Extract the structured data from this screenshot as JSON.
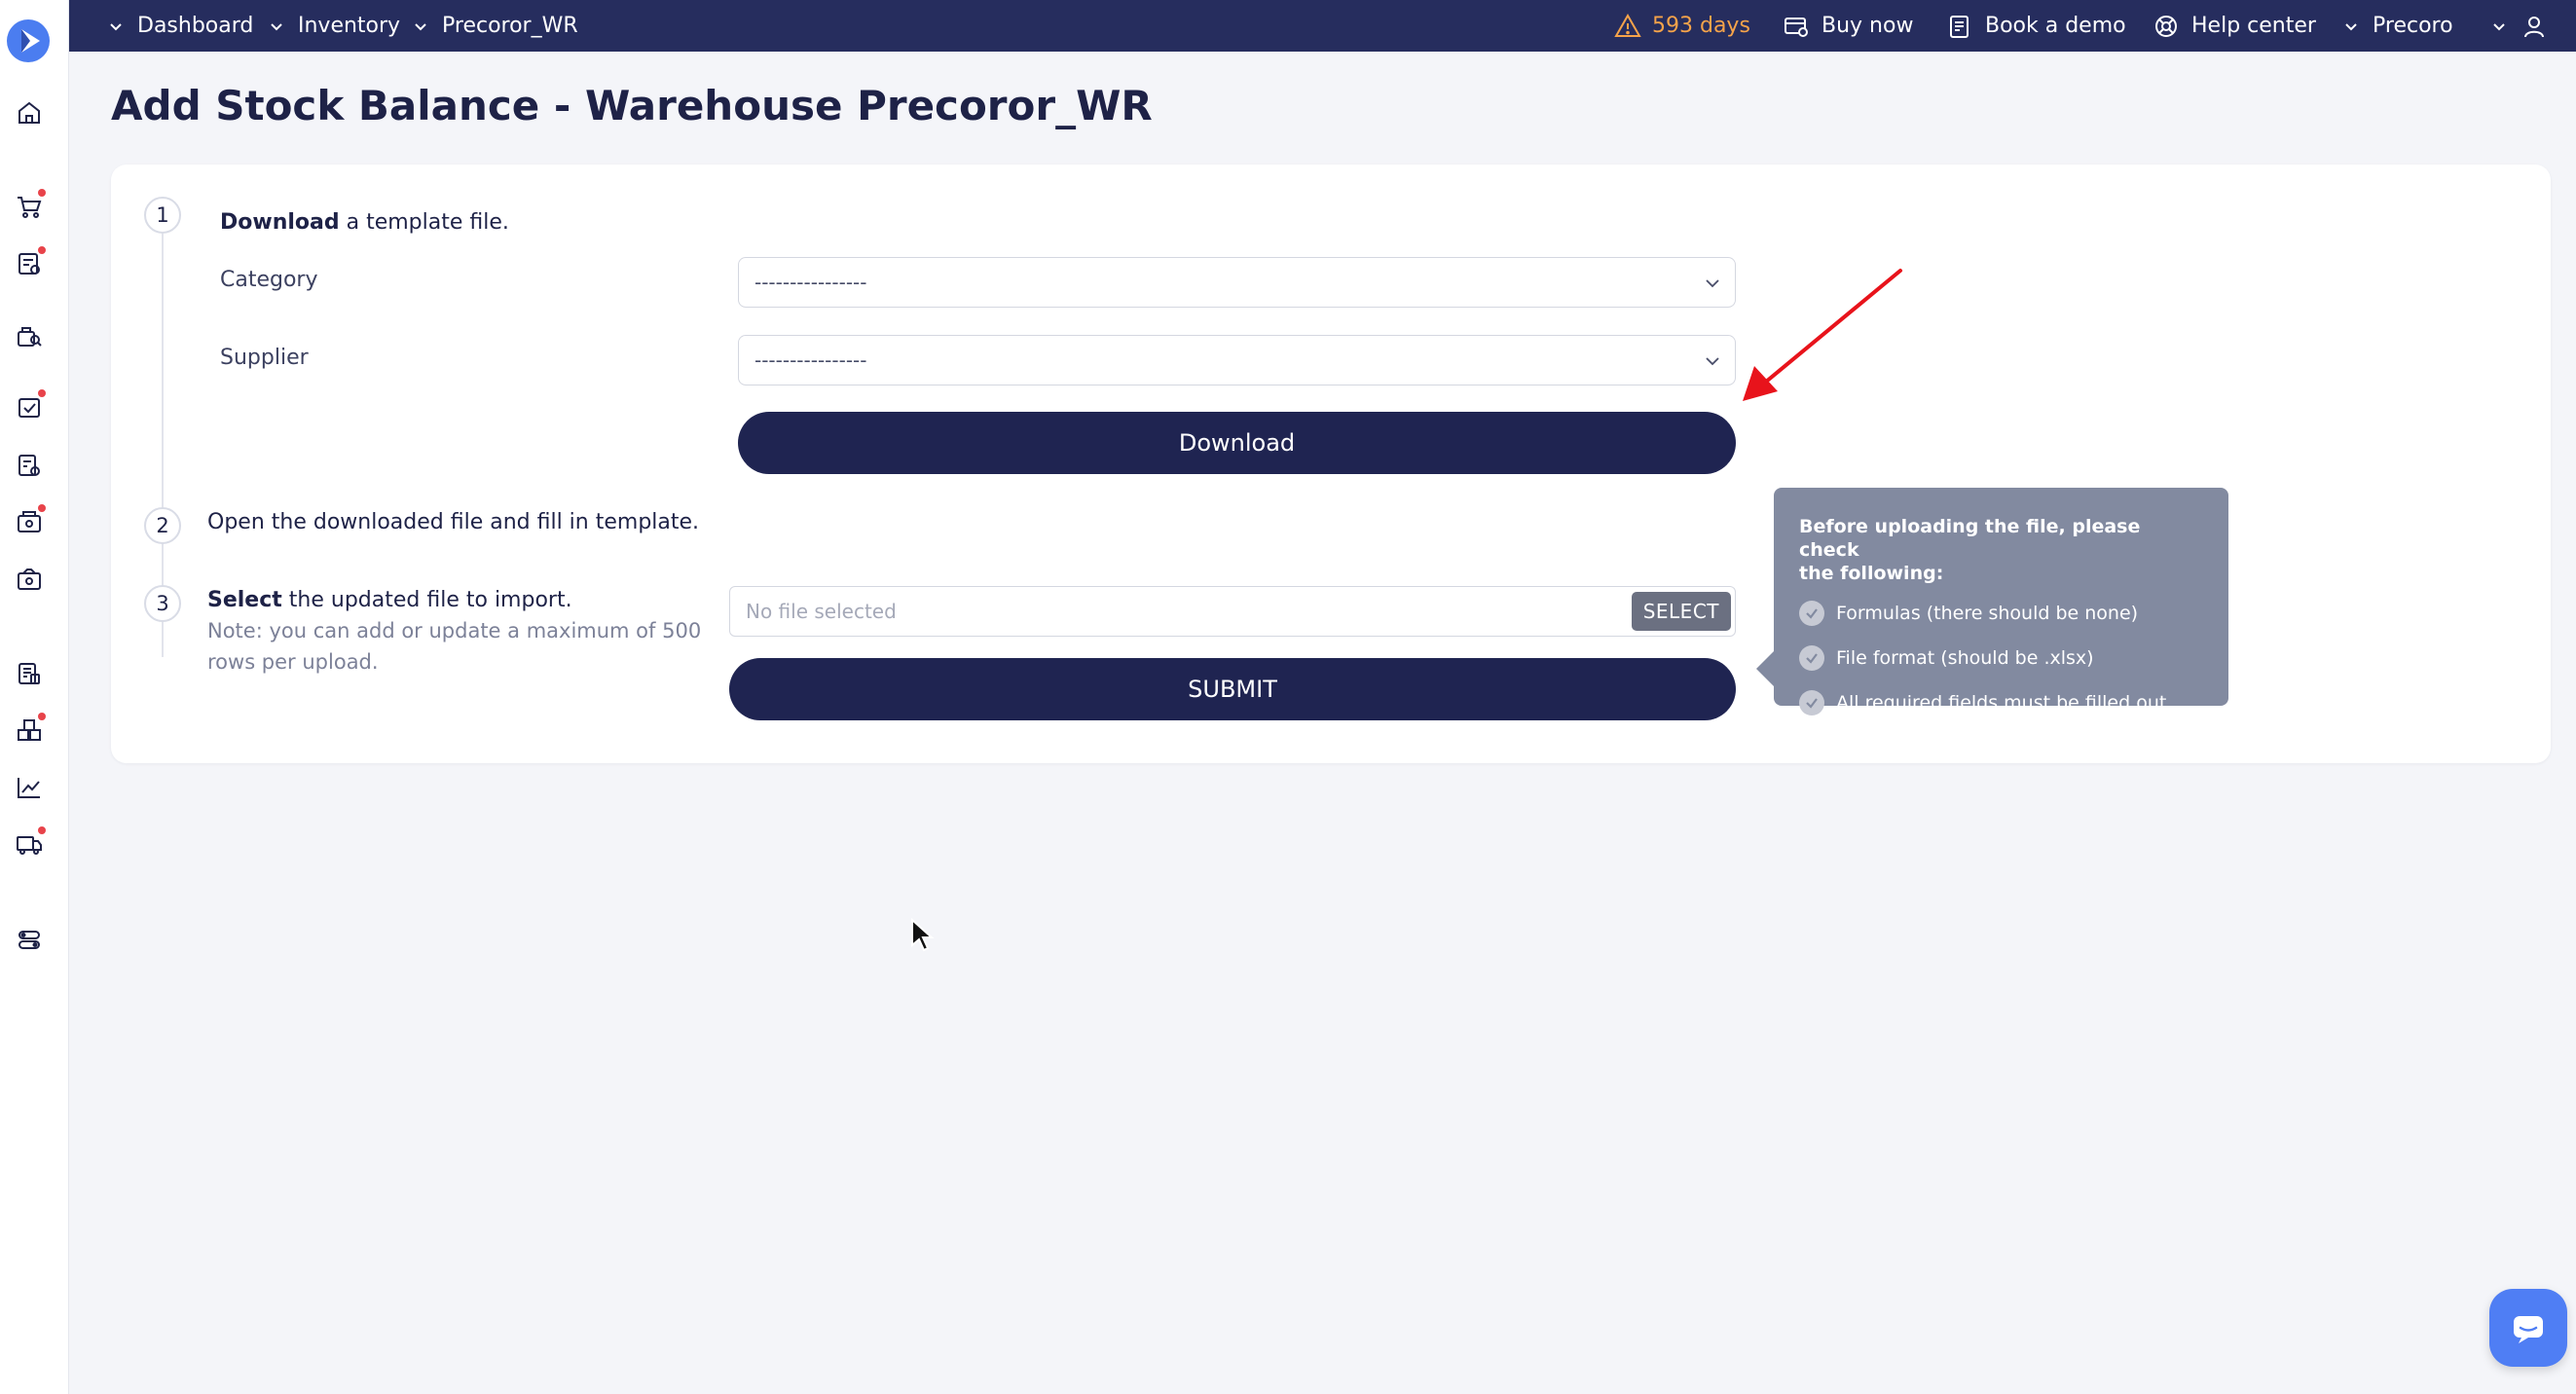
{
  "topbar": {
    "breadcrumb": [
      "Dashboard",
      "Inventory",
      "Precoror_WR"
    ],
    "trial_days": "593 days",
    "buy_now": "Buy now",
    "book_demo": "Book a demo",
    "help_center": "Help center",
    "company": "Precoro"
  },
  "sidebar": {
    "icons": [
      "home-icon",
      "purchase-cart-icon",
      "invoice-icon",
      "warehouse-icon",
      "approvals-icon",
      "receipts-icon",
      "payments-icon",
      "budgets-icon",
      "catalog-icon",
      "inventory-icon",
      "analytics-icon",
      "supplier-delivery-icon",
      "settings-icon"
    ]
  },
  "page": {
    "title": "Add Stock Balance - Warehouse Precoror_WR"
  },
  "step1": {
    "number": "1",
    "bold": "Download",
    "text": " a template file.",
    "category_label": "Category",
    "category_value": "----------------",
    "supplier_label": "Supplier",
    "supplier_value": "----------------",
    "download_button": "Download"
  },
  "step2": {
    "number": "2",
    "text": "Open the downloaded file and fill in template."
  },
  "step3": {
    "number": "3",
    "bold": "Select",
    "text": " the updated file to import.",
    "note_line1": "Note: you can add or update a maximum of 500",
    "note_line2": "rows per upload.",
    "file_placeholder": "No file selected",
    "select_button": "SELECT",
    "submit_button": "SUBMIT"
  },
  "tooltip": {
    "title_line1": "Before uploading the file, please check",
    "title_line2": "the following:",
    "items": [
      "Formulas (there should be none)",
      "File format (should be .xlsx)",
      "All required fields must be filled out"
    ]
  },
  "colors": {
    "topbar": "#262d5e",
    "primary_button": "#1f2451",
    "warning": "#f5a34a",
    "badge": "#e8434a",
    "tooltip": "#828aa0",
    "chat": "#4f7ef4"
  }
}
